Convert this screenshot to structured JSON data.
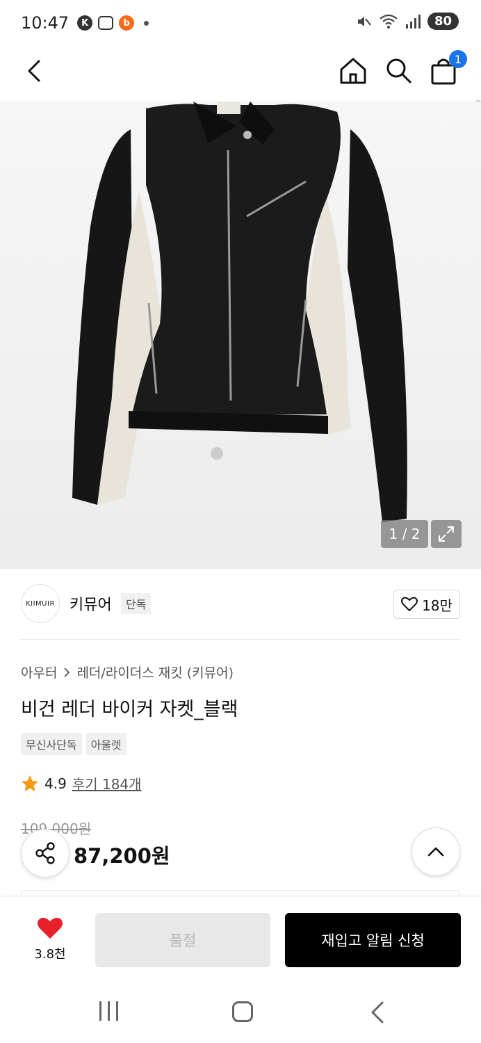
{
  "status_bar": {
    "time": "10:47",
    "mini_badge": "K",
    "mini_orange": "b",
    "battery": "80"
  },
  "header": {
    "cart_count": "1"
  },
  "gallery": {
    "brand_label_on_image": "KIIMUIR",
    "counter": "1 / 2"
  },
  "brand": {
    "logo_text": "KIIMUIR",
    "name": "키뮤어",
    "tag": "단독",
    "like_count": "18만"
  },
  "product": {
    "breadcrumb": [
      "아우터",
      "레더/라이더스 재킷 (키뮤어)"
    ],
    "title": "비건 레더 바이커 자켓_블랙",
    "tags": [
      "무신사단독",
      "아울렛"
    ],
    "rating": "4.9",
    "review_link": "후기 184개",
    "original_price": "109,000원",
    "sale_price": "87,200원"
  },
  "actions": {
    "like_total": "3.8천",
    "soldout_label": "품절",
    "restock_label": "재입고 알림 신청"
  },
  "colors": {
    "accent_blue": "#1a73e8",
    "heart_red": "#e8202a",
    "star_orange": "#f59a12",
    "button_black": "#000000"
  }
}
